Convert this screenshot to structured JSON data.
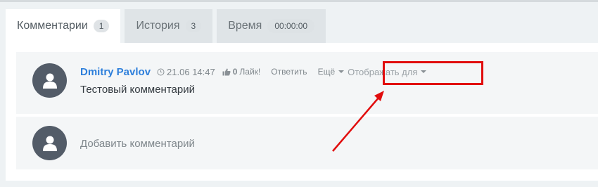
{
  "tabs": [
    {
      "label": "Комментарии",
      "badge": "1"
    },
    {
      "label": "История",
      "badge": "3"
    },
    {
      "label": "Время",
      "badge": "00:00:00"
    }
  ],
  "comment": {
    "author": "Dmitry Pavlov",
    "date": "21.06 14:47",
    "likes": "0",
    "like_label": "Лайк!",
    "reply_label": "Ответить",
    "more_label": "Ещё",
    "display_for_label": "Отображать для",
    "text": "Тестовый комментарий"
  },
  "add_comment": {
    "placeholder": "Добавить комментарий"
  },
  "colors": {
    "author": "#2d7fdb",
    "annotation": "#e10d0d",
    "avatar": "#535c68"
  },
  "icons": {
    "avatar": "user-silhouette-icon",
    "clock": "clock-icon",
    "like": "thumbs-up-icon",
    "caret": "caret-down-icon"
  }
}
